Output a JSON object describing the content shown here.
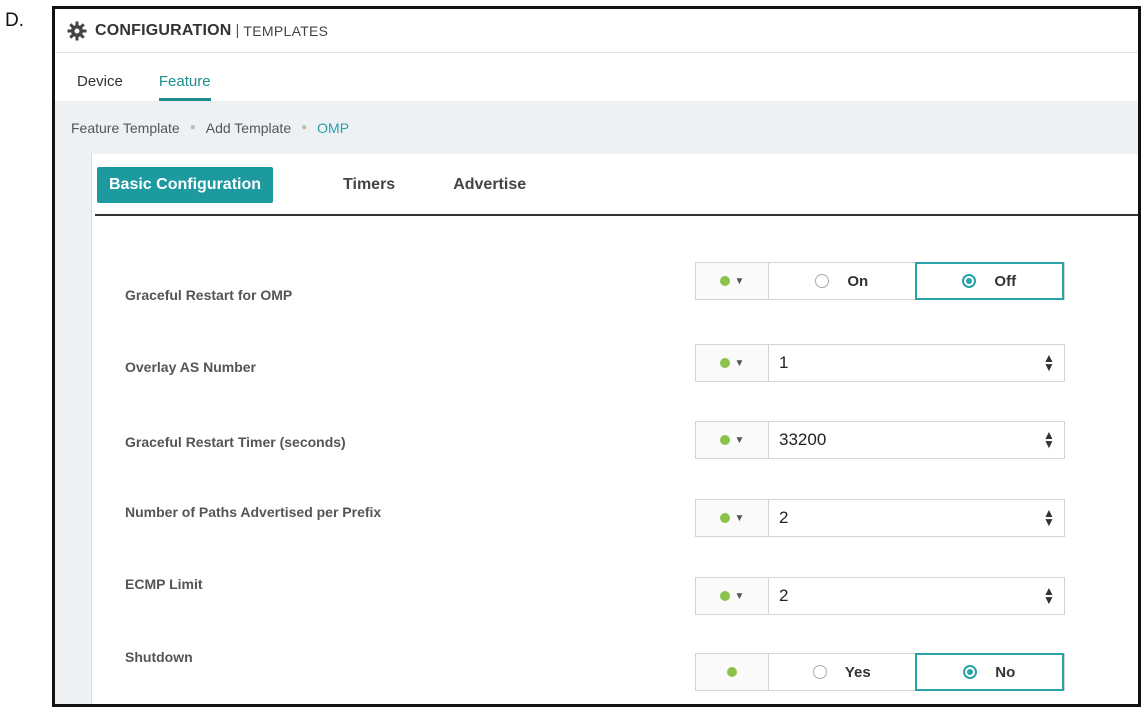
{
  "option_letter": "D.",
  "header": {
    "title": "CONFIGURATION",
    "separator": "|",
    "subtitle": "TEMPLATES"
  },
  "top_tabs": [
    {
      "label": "Device"
    },
    {
      "label": "Feature"
    }
  ],
  "active_top_tab": "Feature",
  "breadcrumb": [
    "Feature Template",
    "Add Template",
    "OMP"
  ],
  "section_tabs": [
    {
      "label": "Basic Configuration"
    },
    {
      "label": "Timers"
    },
    {
      "label": "Advertise"
    }
  ],
  "active_section_tab": "Basic Configuration",
  "fields": {
    "graceful_restart": {
      "label": "Graceful Restart for OMP",
      "options": [
        "On",
        "Off"
      ],
      "selected": "Off"
    },
    "overlay_as": {
      "label": "Overlay AS Number",
      "value": "1"
    },
    "graceful_timer": {
      "label": "Graceful Restart Timer (seconds)",
      "value": "33200"
    },
    "paths_advertised": {
      "label": "Number of Paths Advertised per Prefix",
      "value": "2"
    },
    "ecmp_limit": {
      "label": "ECMP Limit",
      "value": "2"
    },
    "shutdown": {
      "label": "Shutdown",
      "options": [
        "Yes",
        "No"
      ],
      "selected": "No"
    }
  },
  "colors": {
    "accent": "#1d9aa0",
    "global_icon": "#8bc34a"
  },
  "icons": {
    "header": "gear-icon",
    "scope": "globe-icon"
  }
}
